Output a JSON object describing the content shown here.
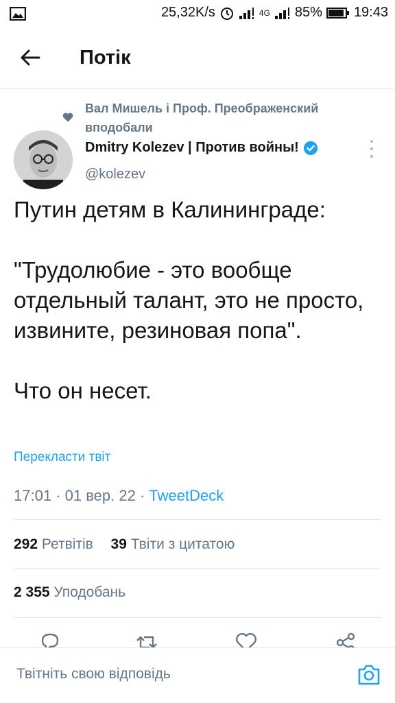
{
  "status_bar": {
    "net_speed": "25,32K/s",
    "network": "4G",
    "battery": "85%",
    "time": "19:43"
  },
  "header": {
    "title": "Потік"
  },
  "tweet": {
    "liked_by": "Вал Мишель і Проф. Преображенский вподобали",
    "author": {
      "name": "Dmitry Kolezev | Против войны!",
      "handle": "@kolezev",
      "verified": true
    },
    "text_paragraphs": [
      "Путин детям в Калининграде:",
      "\"Трудолюбие - это вообще отдельный талант, это не просто, извините, резиновая попа\".",
      "Что он несет."
    ],
    "translate_label": "Перекласти твіт",
    "time": "17:01",
    "date": "01 вер. 22",
    "source": "TweetDeck",
    "retweets": {
      "count": "292",
      "label": "Ретвітів"
    },
    "quotes": {
      "count": "39",
      "label": "Твіти з цитатою"
    },
    "likes": {
      "count": "2 355",
      "label": "Уподобань"
    }
  },
  "reply": {
    "placeholder": "Твітніть свою відповідь"
  },
  "colors": {
    "accent": "#1da1f2",
    "secondary_text": "#657786",
    "divider": "#e1e8ed"
  }
}
